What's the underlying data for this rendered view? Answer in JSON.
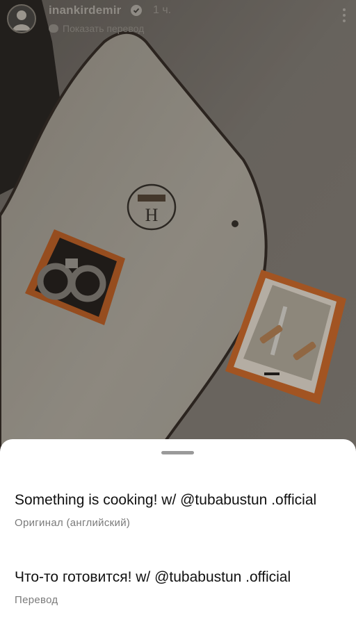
{
  "post": {
    "username": "inankirdemir",
    "time": "1 ч.",
    "show_translation": "Показать перевод"
  },
  "icons": {
    "verified": "verified-badge-icon",
    "more": "more-vertical-icon",
    "translate": "translate-icon"
  },
  "sheet": {
    "original_text": "Something is cooking! w/ @tubabustun .official",
    "original_label": "Оригинал (английский)",
    "translated_text": "Что-то готовится! w/ @tubabustun .official",
    "translated_label": "Перевод"
  },
  "colors": {
    "sheet_bg": "#ffffff",
    "primary_text": "#111111",
    "secondary_text": "#7a7a7a",
    "box_orange": "#d4692a"
  }
}
